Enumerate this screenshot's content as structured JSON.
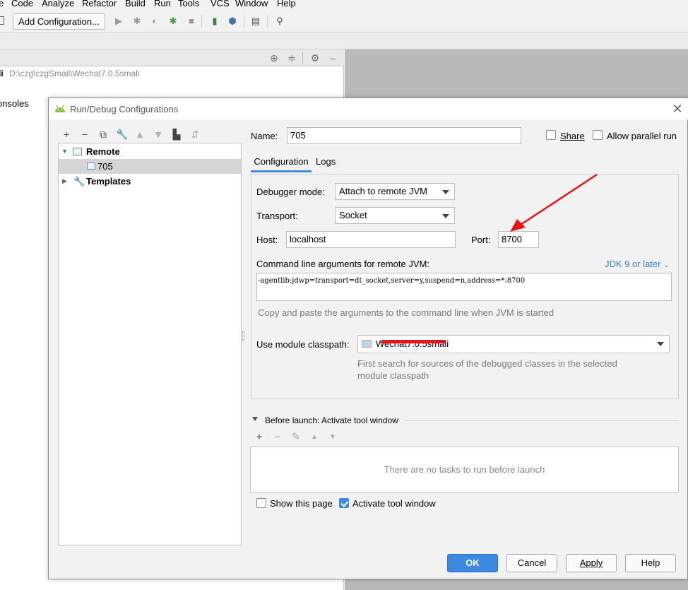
{
  "menu": [
    "e",
    "Code",
    "Analyze",
    "Refactor",
    "Build",
    "Run",
    "Tools",
    "VCS",
    "Window",
    "Help"
  ],
  "toolbar": {
    "run_config": "Add Configuration..."
  },
  "project": {
    "name_fragment": "li",
    "path": "D:\\czg\\czgSmail\\Wechat7.0.5smali",
    "consoles_fragment": "onsoles"
  },
  "dialog": {
    "title": "Run/Debug Configurations",
    "close": "✕",
    "name_label": "Name:",
    "name_value": "705",
    "share_label": "Share",
    "share_checked": false,
    "parallel_label": "Allow parallel run",
    "parallel_checked": false,
    "tree": {
      "remote": "Remote",
      "remote_child": "705",
      "templates": "Templates"
    },
    "tabs": [
      "Configuration",
      "Logs"
    ],
    "config": {
      "debugger_mode_label": "Debugger mode:",
      "debugger_mode_value": "Attach to remote JVM",
      "transport_label": "Transport:",
      "transport_value": "Socket",
      "host_label": "Host:",
      "host_value": "localhost",
      "port_label": "Port:",
      "port_value": "8700",
      "args_label": "Command line arguments for remote JVM:",
      "jdk_link": "JDK 9 or later",
      "args_value": "-agentlib:jdwp=transport=dt_socket,server=y,suspend=n,address=*:8700",
      "args_hint": "Copy and paste the arguments to the command line when JVM is started",
      "module_label": "Use module classpath:",
      "module_value": "Wechat7.0.5smali",
      "module_hint_1": "First search for sources of the debugged classes in the selected",
      "module_hint_2": "module classpath"
    },
    "before_launch": {
      "title": "Before launch: Activate tool window",
      "empty": "There are no tasks to run before launch"
    },
    "show_page_label": "Show this page",
    "show_page_checked": false,
    "activate_label": "Activate tool window",
    "activate_checked": true,
    "buttons": {
      "ok": "OK",
      "cancel": "Cancel",
      "apply": "Apply",
      "help": "Help"
    }
  },
  "colors": {
    "accent": "#3d8ae0",
    "annotation": "#e8141a",
    "link": "#3d7bd6"
  }
}
